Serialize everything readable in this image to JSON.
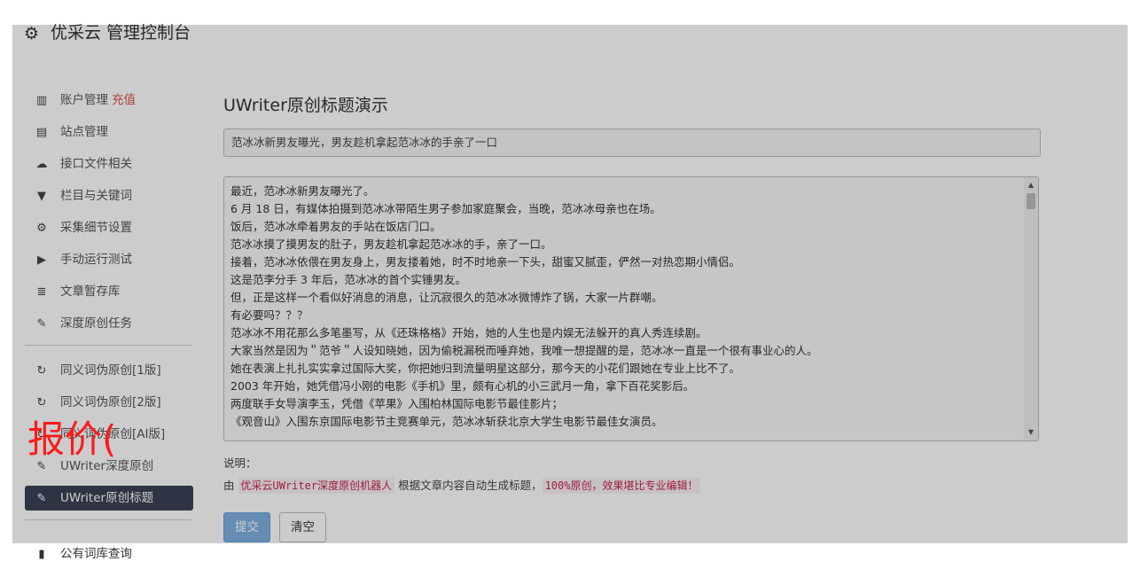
{
  "header": {
    "gear_icon": "⚙",
    "title": "优采云 管理控制台"
  },
  "sidebar": {
    "items": [
      {
        "icon": "bar-chart-icon",
        "glyph": "▥",
        "label": "账户管理",
        "accent": "充值"
      },
      {
        "icon": "server-icon",
        "glyph": "▤",
        "label": "站点管理"
      },
      {
        "icon": "cloud-upload-icon",
        "glyph": "☁",
        "label": "接口文件相关"
      },
      {
        "icon": "filter-icon",
        "glyph": "▼",
        "label": "栏目与关键词"
      },
      {
        "icon": "cogs-icon",
        "glyph": "⚙",
        "label": "采集细节设置"
      },
      {
        "icon": "play-circle-icon",
        "glyph": "▶",
        "label": "手动运行测试"
      },
      {
        "icon": "database-icon",
        "glyph": "≣",
        "label": "文章暂存库"
      },
      {
        "icon": "edit-icon",
        "glyph": "✎",
        "label": "深度原创任务"
      }
    ],
    "items2": [
      {
        "icon": "refresh-icon",
        "glyph": "↻",
        "label": "同义词伪原创[1版]"
      },
      {
        "icon": "refresh-icon",
        "glyph": "↻",
        "label": "同义词伪原创[2版]"
      },
      {
        "icon": "refresh-icon",
        "glyph": "↻",
        "label": "同义词伪原创[AI版]"
      },
      {
        "icon": "edit-icon",
        "glyph": "✎",
        "label": "UWriter深度原创"
      },
      {
        "icon": "edit-icon",
        "glyph": "✎",
        "label": "UWriter原创标题",
        "active": true
      }
    ],
    "footer_item": {
      "icon": "book-icon",
      "glyph": "▮",
      "label": "公有词库查询"
    }
  },
  "main": {
    "page_title": "UWriter原创标题演示",
    "title_value": "范冰冰新男友曝光，男友趁机拿起范冰冰的手亲了一口",
    "content_lines": [
      "最近，范冰冰新男友曝光了。",
      "6 月 18 日，有媒体拍摄到范冰冰带陌生男子参加家庭聚会，当晚，范冰冰母亲也在场。",
      "饭后，范冰冰牵着男友的手站在饭店门口。",
      "范冰冰摸了摸男友的肚子，男友趁机拿起范冰冰的手，亲了一口。",
      "接着，范冰冰依偎在男友身上，男友搂着她，时不时地亲一下头，甜蜜又腻歪，俨然一对热恋期小情侣。",
      "这是范李分手 3 年后，范冰冰的首个实锤男友。",
      "但，正是这样一个看似好消息的消息，让沉寂很久的范冰冰微博炸了锅，大家一片群嘲。",
      "有必要吗？？？",
      "范冰冰不用花那么多笔墨写，从《还珠格格》开始，她的人生也是内娱无法躲开的真人秀连续剧。",
      "大家当然是因为＂范爷＂人设知晓她，因为偷税漏税而唾弃她，我唯一想提醒的是，范冰冰一直是一个很有事业心的人。",
      "她在表演上扎扎实实拿过国际大奖，你把她归到流量明星这部分，那今天的小花们跟她在专业上比不了。",
      "2003 年开始，她凭借冯小刚的电影《手机》里，颇有心机的小三武月一角，拿下百花奖影后。",
      "两度联手女导演李玉，凭借《苹果》入围柏林国际电影节最佳影片；",
      "《观音山》入围东京国际电影节主竞赛单元，范冰冰斩获北京大学生电影节最佳女演员。"
    ],
    "note_label": "说明：",
    "note_prefix": "由",
    "note_highlight1": "优采云UWriter深度原创机器人",
    "note_middle": "根据文章内容自动生成标题，",
    "note_highlight2": "100%原创，效果堪比专业编辑！",
    "submit_label": "提交",
    "clear_label": "清空"
  },
  "stamp_text": "报价(",
  "colors": {
    "active_bg": "#3a4254",
    "accent_red": "#d9534f",
    "primary_btn": "#7fb0e0",
    "stamp_red": "#ff1a1a"
  }
}
